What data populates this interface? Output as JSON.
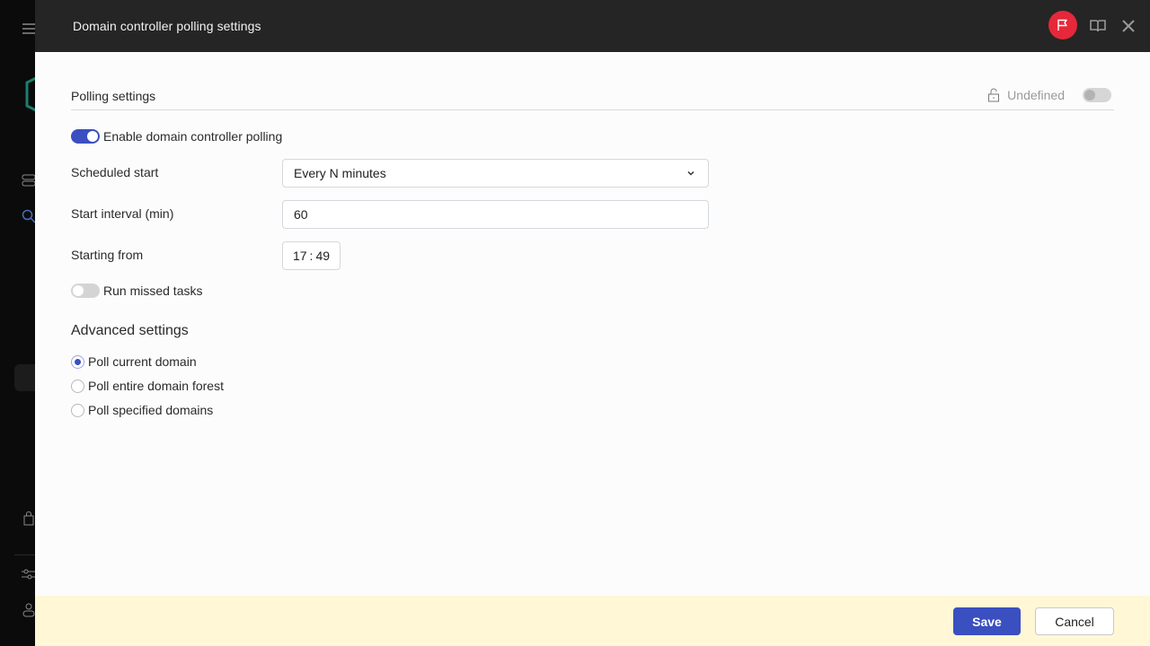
{
  "app_sidebar": {
    "icons": [
      "menu-icon",
      "logo",
      "stack-icon",
      "search-icon",
      "bag-icon",
      "sliders-icon",
      "user-icon"
    ]
  },
  "dialog": {
    "title": "Domain controller polling settings",
    "header_icons": [
      "flag-icon",
      "book-icon",
      "close-icon"
    ],
    "colors": {
      "accent": "#3a4fc0",
      "flag": "#e5283a",
      "footer": "#fff7d6",
      "header": "#252525"
    }
  },
  "polling": {
    "section_title": "Polling settings",
    "policy_state_label": "Undefined",
    "policy_toggle_on": false,
    "enable_toggle": {
      "label": "Enable domain controller polling",
      "on": true
    },
    "scheduled_start": {
      "label": "Scheduled start",
      "value": "Every N minutes"
    },
    "start_interval": {
      "label": "Start interval (min)",
      "value": "60"
    },
    "starting_from": {
      "label": "Starting from",
      "hours": "17",
      "separator": ":",
      "minutes": "49"
    },
    "run_missed": {
      "label": "Run missed tasks",
      "on": false
    }
  },
  "advanced": {
    "title": "Advanced settings",
    "options": [
      {
        "label": "Poll current domain",
        "checked": true
      },
      {
        "label": "Poll entire domain forest",
        "checked": false
      },
      {
        "label": "Poll specified domains",
        "checked": false
      }
    ]
  },
  "footer": {
    "save_label": "Save",
    "cancel_label": "Cancel"
  }
}
